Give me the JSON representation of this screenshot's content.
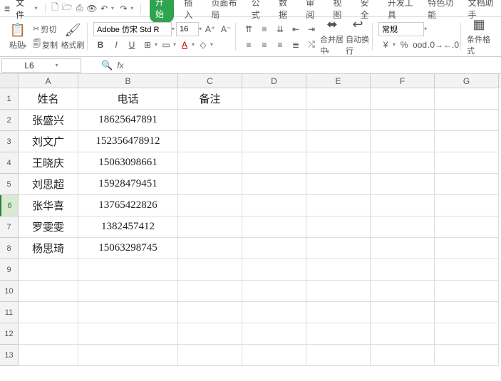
{
  "menubar": {
    "file_label": "文件",
    "tabs": [
      "开始",
      "插入",
      "页面布局",
      "公式",
      "数据",
      "审阅",
      "视图",
      "安全",
      "开发工具",
      "特色功能",
      "文档助手"
    ],
    "active_tab": 0
  },
  "ribbon": {
    "paste_label": "粘贴",
    "cut_label": "剪切",
    "copy_label": "复制",
    "format_painter_label": "格式刷",
    "font_name": "Adobe 仿宋 Std R",
    "font_size": "16",
    "merge_center_label": "合并居中",
    "wrap_text_label": "自动换行",
    "number_format": "常规",
    "cond_format_label": "条件格式"
  },
  "formula_bar": {
    "cell_ref": "L6",
    "fx_label": "fx",
    "formula": ""
  },
  "columns": [
    "A",
    "B",
    "C",
    "D",
    "E",
    "F",
    "G"
  ],
  "row_numbers": [
    1,
    2,
    3,
    4,
    5,
    6,
    7,
    8,
    9,
    10,
    11,
    12,
    13
  ],
  "active_row": 6,
  "chart_data": {
    "type": "table",
    "headers": [
      "姓名",
      "电话",
      "备注"
    ],
    "rows": [
      {
        "name": "张盛兴",
        "phone": "18625647891",
        "note": ""
      },
      {
        "name": "刘文广",
        "phone": "152356478912",
        "note": ""
      },
      {
        "name": "王晓庆",
        "phone": "15063098661",
        "note": ""
      },
      {
        "name": "刘思超",
        "phone": "15928479451",
        "note": ""
      },
      {
        "name": "张华喜",
        "phone": "13765422826",
        "note": ""
      },
      {
        "name": "罗雯雯",
        "phone": "1382457412",
        "note": ""
      },
      {
        "name": "杨思琦",
        "phone": "15063298745",
        "note": ""
      }
    ]
  }
}
